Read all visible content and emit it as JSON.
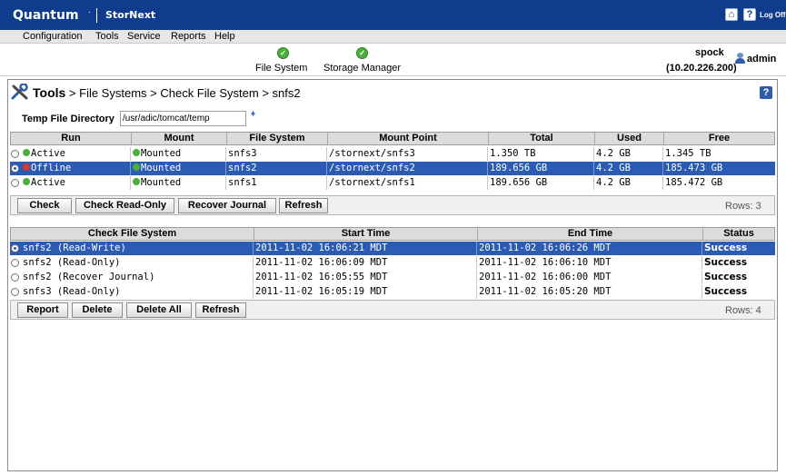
{
  "header": {
    "brand": "Quantum",
    "product": "StorNext",
    "logoff_label": "Log Off"
  },
  "menu": [
    "Configuration",
    "Tools",
    "Service",
    "Reports",
    "Help"
  ],
  "services": [
    {
      "label": "File System",
      "status": "ok"
    },
    {
      "label": "Storage Manager",
      "status": "ok"
    }
  ],
  "host": {
    "name": "spock",
    "ip": "(10.20.226.200)",
    "user": "admin"
  },
  "breadcrumb": {
    "root": "Tools",
    "path": "> File Systems > Check File System > snfs2"
  },
  "temp_dir": {
    "label": "Temp File Directory",
    "value": "/usr/adic/tomcat/temp"
  },
  "fs_table": {
    "columns": [
      "Run",
      "Mount",
      "File System",
      "Mount Point",
      "Total",
      "Used",
      "Free"
    ],
    "rows": [
      {
        "run": "Active",
        "run_status": "ok",
        "mount": "Mounted",
        "fs": "snfs3",
        "mount_point": "/stornext/snfs3",
        "total": "1.350 TB",
        "used": "4.2 GB",
        "free": "1.345 TB",
        "selected": false
      },
      {
        "run": "Offline",
        "run_status": "error",
        "mount": "Mounted",
        "fs": "snfs2",
        "mount_point": "/stornext/snfs2",
        "total": "189.656 GB",
        "used": "4.2 GB",
        "free": "185.473 GB",
        "selected": true
      },
      {
        "run": "Active",
        "run_status": "ok",
        "mount": "Mounted",
        "fs": "snfs1",
        "mount_point": "/stornext/snfs1",
        "total": "189.656 GB",
        "used": "4.2 GB",
        "free": "185.472 GB",
        "selected": false
      }
    ],
    "buttons": [
      "Check",
      "Check Read-Only",
      "Recover Journal",
      "Refresh"
    ],
    "rows_label": "Rows: 3"
  },
  "check_table": {
    "columns": [
      "Check File System",
      "Start Time",
      "End Time",
      "Status"
    ],
    "rows": [
      {
        "name": "snfs2 (Read-Write)",
        "start": "2011-11-02 16:06:21 MDT",
        "end": "2011-11-02 16:06:26 MDT",
        "status": "Success",
        "selected": true
      },
      {
        "name": "snfs2 (Read-Only)",
        "start": "2011-11-02 16:06:09 MDT",
        "end": "2011-11-02 16:06:10 MDT",
        "status": "Success",
        "selected": false
      },
      {
        "name": "snfs2 (Recover Journal)",
        "start": "2011-11-02 16:05:55 MDT",
        "end": "2011-11-02 16:06:00 MDT",
        "status": "Success",
        "selected": false
      },
      {
        "name": "snfs3 (Read-Only)",
        "start": "2011-11-02 16:05:19 MDT",
        "end": "2011-11-02 16:05:20 MDT",
        "status": "Success",
        "selected": false
      }
    ],
    "buttons": [
      "Report",
      "Delete",
      "Delete All",
      "Refresh"
    ],
    "rows_label": "Rows: 4"
  }
}
